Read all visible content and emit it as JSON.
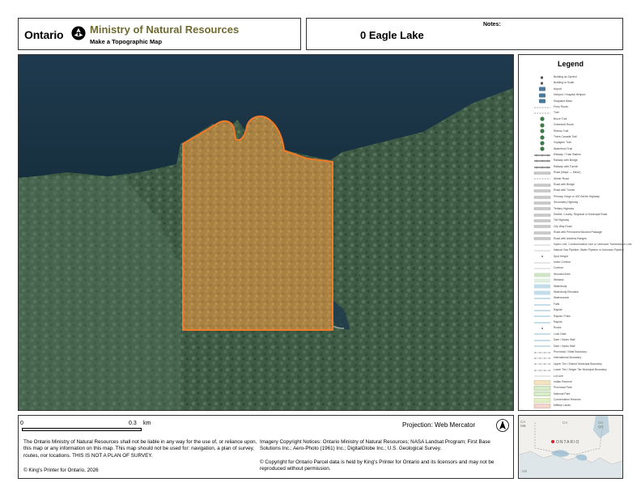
{
  "header": {
    "government": "Ontario",
    "ministry": "Ministry of Natural Resources",
    "subtitle": "Make a Topographic Map",
    "notes_label": "Notes:",
    "map_title": "0 Eagle Lake"
  },
  "map": {
    "parcel_outline_color": "#f07a28",
    "parcel_fill_color": "#e8913c",
    "water_color": "#1b3345",
    "forest_color": "#3e5a44"
  },
  "legend": {
    "title": "Legend",
    "items": [
      {
        "label": "Building as Symbol",
        "symbol": "square-small"
      },
      {
        "label": "Building to Scale",
        "symbol": "square-small"
      },
      {
        "label": "Airport",
        "symbol": "airport-icon"
      },
      {
        "label": "Heliport / Hospital Heliport",
        "symbol": "heliport-icon"
      },
      {
        "label": "Seaplane Base",
        "symbol": "seaplane-icon"
      },
      {
        "label": "Ferry Route",
        "symbol": "dash-line"
      },
      {
        "label": "Trail",
        "symbol": "dash-line"
      },
      {
        "label": "Bruce Trail",
        "symbol": "trail-icon"
      },
      {
        "label": "Greenbelt Route",
        "symbol": "trail-icon"
      },
      {
        "label": "Rideau Trail",
        "symbol": "trail-icon"
      },
      {
        "label": "Trans Canada Trail",
        "symbol": "trail-icon"
      },
      {
        "label": "Voyageur Trail",
        "symbol": "trail-icon"
      },
      {
        "label": "Waterfront Trail",
        "symbol": "trail-icon"
      },
      {
        "label": "Railway / Train Station",
        "symbol": "rail-line"
      },
      {
        "label": "Railway with Bridge",
        "symbol": "rail-line"
      },
      {
        "label": "Railway with Tunnel",
        "symbol": "rail-line"
      },
      {
        "label": "Road (Major — Minor)",
        "symbol": "road-line"
      },
      {
        "label": "Winter Road",
        "symbol": "dash-line"
      },
      {
        "label": "Road with Bridge",
        "symbol": "road-line"
      },
      {
        "label": "Road with Tunnel",
        "symbol": "road-line"
      },
      {
        "label": "Primary, Kings or 400 Series Highway",
        "symbol": "road-line"
      },
      {
        "label": "Secondary Highway",
        "symbol": "road-line"
      },
      {
        "label": "Tertiary Highway",
        "symbol": "road-line"
      },
      {
        "label": "District, County, Regional or Municipal Road",
        "symbol": "road-line"
      },
      {
        "label": "Toll Highway",
        "symbol": "road-line"
      },
      {
        "label": "City Way Road",
        "symbol": "road-line"
      },
      {
        "label": "Road with Permanent Blocked Passage",
        "symbol": "road-line"
      },
      {
        "label": "Road with Address Ranges",
        "symbol": "road-line"
      },
      {
        "label": "Hydro Line, Communication Line or Unknown Transmission Line",
        "symbol": "thin-line"
      },
      {
        "label": "Natural Gas Pipeline, Water Pipeline or Unknown Pipeline",
        "symbol": "thin-line"
      },
      {
        "label": "Spot Height",
        "symbol": "dot"
      },
      {
        "label": "Index Contour",
        "symbol": "thin-line"
      },
      {
        "label": "Contour",
        "symbol": "thin-line"
      },
      {
        "label": "Wooded Area",
        "symbol": "green-fill"
      },
      {
        "label": "Wetland",
        "symbol": "wetland-fill"
      },
      {
        "label": "Waterbody",
        "symbol": "water-fill"
      },
      {
        "label": "Waterbody Elevation",
        "symbol": "water-fill"
      },
      {
        "label": "Watercourse",
        "symbol": "blue-line"
      },
      {
        "label": "Falls",
        "symbol": "blue-line"
      },
      {
        "label": "Rapids",
        "symbol": "blue-line"
      },
      {
        "label": "Rapids / Falls",
        "symbol": "blue-line"
      },
      {
        "label": "Rapids",
        "symbol": "blue-line"
      },
      {
        "label": "Rocks",
        "symbol": "dot"
      },
      {
        "label": "Lock Gate",
        "symbol": "blue-line"
      },
      {
        "label": "Dam / Hydro Wall",
        "symbol": "blue-line"
      },
      {
        "label": "Dam / Hydro Wall",
        "symbol": "blue-line"
      },
      {
        "label": "Provincial / State Boundary",
        "symbol": "boundary-line"
      },
      {
        "label": "International Boundary",
        "symbol": "boundary-line"
      },
      {
        "label": "Upper Tier / District Municipal Boundary",
        "symbol": "boundary-line"
      },
      {
        "label": "Lower Tier / Single Tier Municipal Boundary",
        "symbol": "boundary-line"
      },
      {
        "label": "Lot Line",
        "symbol": "thin-line"
      },
      {
        "label": "Indian Reserve",
        "symbol": "reserve-fill"
      },
      {
        "label": "Provincial Park",
        "symbol": "park-fill"
      },
      {
        "label": "National Park",
        "symbol": "park-fill"
      },
      {
        "label": "Conservation Reserve",
        "symbol": "conservation-fill"
      },
      {
        "label": "Military Lands",
        "symbol": "military-fill"
      }
    ]
  },
  "footer": {
    "scale_start": "0",
    "scale_end": "0.3",
    "scale_unit": "km",
    "projection": "Projection: Web Mercator",
    "disclaimer": "The Ontario Ministry of Natural Resources shall not be liable in any way for the use of, or reliance upon, this map or any information on this map. This map should not be used for: navigation, a plan of survey, routes, nor locations. THIS IS NOT A PLAN OF SURVEY.",
    "kings_printer": "© King's Printer for Ontario,  2026",
    "imagery": "Imagery Copyright Notices: Ontario Ministry of Natural Resources; NASA Landsat Program; First Base Solutions Inc.; Aero-Photo (1961) Inc.; DigitalGlobe Inc.; U.S. Geological Survey.",
    "parcel": "© Copyright for Ontario Parcel data is held by King's Printer for Ontario and its licensors and may not be reproduced without permission."
  },
  "inset": {
    "label_ontario": "ONTARIO",
    "label_ca_mb": "CA MB",
    "label_ca_qc": "CA QC",
    "label_us": "US",
    "label_ca": "CA"
  }
}
